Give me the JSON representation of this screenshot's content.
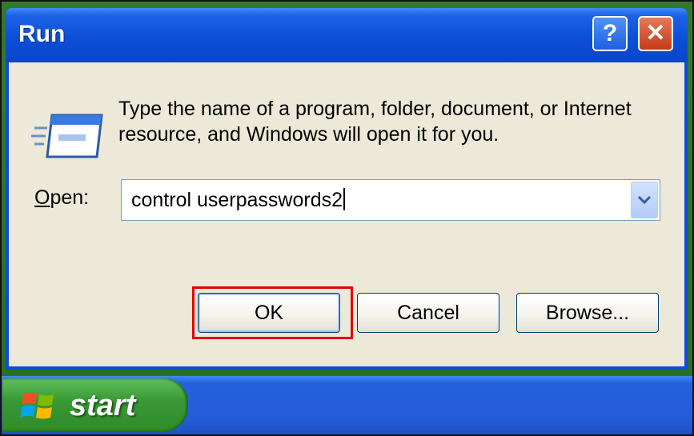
{
  "window": {
    "title": "Run",
    "help_label": "?",
    "close_label": "✕"
  },
  "dialog": {
    "description": "Type the name of a program, folder, document, or Internet resource, and Windows will open it for you.",
    "open_label_accel": "O",
    "open_label_rest": "pen:",
    "open_value": "control userpasswords2"
  },
  "buttons": {
    "ok": "OK",
    "cancel": "Cancel",
    "browse": "Browse..."
  },
  "taskbar": {
    "start_label": "start"
  },
  "colors": {
    "titlebar": "#0c4fd6",
    "dialog_bg": "#ece9d8",
    "highlight": "#e00000",
    "start_green": "#3a9a36"
  }
}
